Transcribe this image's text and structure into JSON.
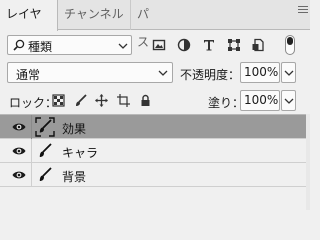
{
  "tabs": [
    {
      "label": "レイヤー",
      "active": true
    },
    {
      "label": "チャンネル",
      "active": false
    },
    {
      "label": "パス",
      "active": false
    }
  ],
  "filter": {
    "kind_label": "種類",
    "icons": [
      "image-filter-icon",
      "adjustment-filter-icon",
      "type-filter-icon",
      "shape-filter-icon",
      "smart-object-filter-icon"
    ],
    "toggle_icon": "filter-toggle-icon"
  },
  "blend": {
    "mode": "通常",
    "opacity_label": "不透明度：",
    "opacity_value": "100%"
  },
  "lock": {
    "label": "ロック：",
    "icons": [
      "lock-transparent-pixels-icon",
      "lock-image-pixels-icon",
      "lock-position-icon",
      "lock-artboard-icon",
      "lock-all-icon"
    ],
    "fill_label": "塗り：",
    "fill_value": "100%"
  },
  "layers": [
    {
      "name": "効果",
      "selected": true,
      "visible": true
    },
    {
      "name": "キャラ",
      "selected": false,
      "visible": true
    },
    {
      "name": "背景",
      "selected": false,
      "visible": true
    }
  ],
  "colors": {
    "panel_bg": "#f0f0f0",
    "selected_row": "#9a9a9a",
    "tab_bar": "#e4e4e4"
  }
}
